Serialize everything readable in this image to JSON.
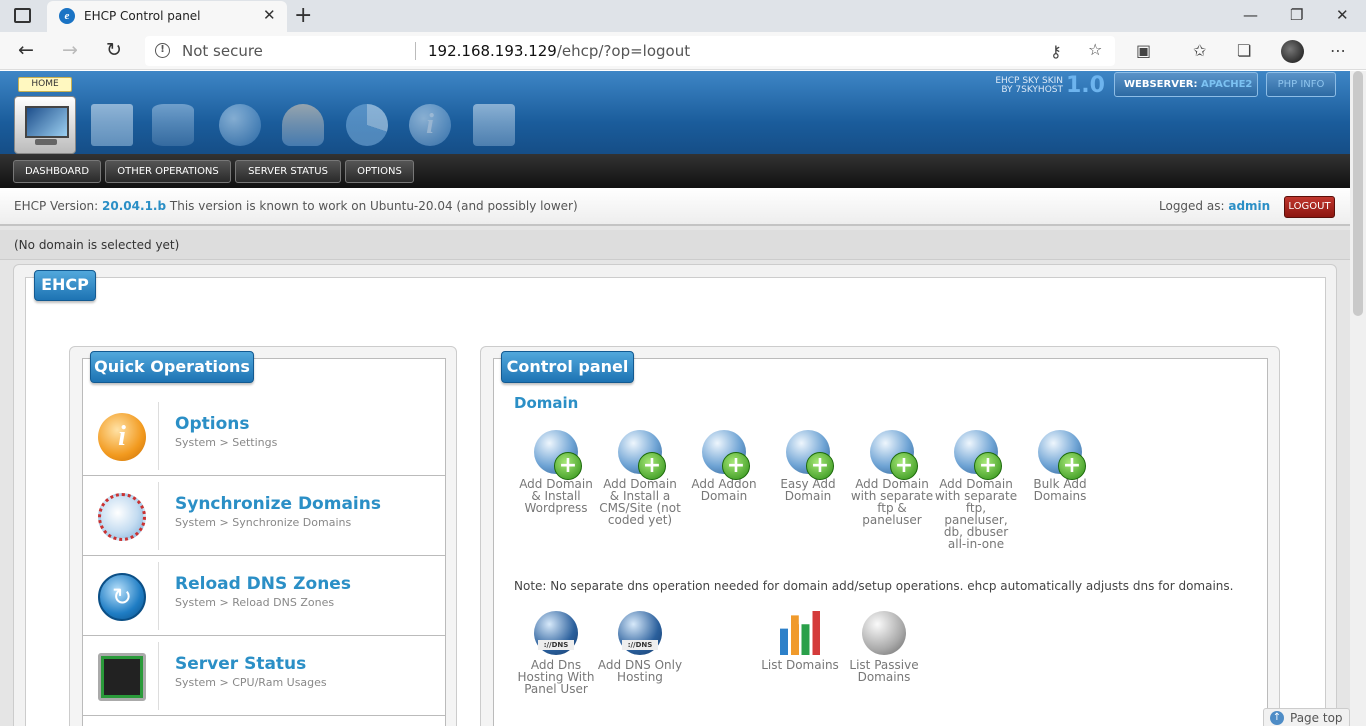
{
  "browser": {
    "tab_title": "EHCP Control panel",
    "tab_close": "✕",
    "new_tab": "+",
    "not_secure": "Not secure",
    "url_host": "192.168.193.129",
    "url_path": "/ehcp/?op=logout",
    "window_min": "—",
    "window_max": "❐",
    "window_close": "✕"
  },
  "header": {
    "home_badge": "HOME",
    "skin_line1": "EHCP SKY SKIN",
    "skin_line2": "BY 7SKYHOST",
    "skin_version": "1.0",
    "webserver_label": "WEBSERVER:",
    "webserver_value": "APACHE2",
    "php_info": "PHP INFO"
  },
  "menu": {
    "dashboard": "DASHBOARD",
    "other_operations": "OTHER OPERATIONS",
    "server_status": "SERVER STATUS",
    "options": "OPTIONS"
  },
  "info": {
    "version_label": "EHCP Version:",
    "version": "20.04.1.b",
    "version_note": "This version is known to work on Ubuntu-20.04 (and possibly lower)",
    "logged_label": "Logged as:",
    "user": "admin",
    "logout": "LOGOUT"
  },
  "domain_status": "(No domain is selected yet)",
  "main_tab": "EHCP",
  "quick_ops": {
    "title": "Quick Operations",
    "items": [
      {
        "title": "Options",
        "sub": "System > Settings",
        "color": "#f29a1f"
      },
      {
        "title": "Synchronize Domains",
        "sub": "System > Synchronize Domains",
        "color": "#c93232"
      },
      {
        "title": "Reload DNS Zones",
        "sub": "System > Reload DNS Zones",
        "color": "#1f7dc4"
      },
      {
        "title": "Server Status",
        "sub": "System > CPU/Ram Usages",
        "color": "#2a9a3a"
      }
    ]
  },
  "control_panel": {
    "title": "Control panel",
    "domain_heading": "Domain",
    "add_items": [
      "Add Domain & Install Wordpress",
      "Add Domain & Install a CMS/Site (not coded yet)",
      "Add Addon Domain",
      "Easy Add Domain",
      "Add Domain with separate ftp & paneluser",
      "Add Domain with separate ftp, paneluser, db, dbuser all-in-one",
      "Bulk Add Domains"
    ],
    "note": "Note: No separate dns operation needed for domain add/setup operations. ehcp automatically adjusts dns for domains.",
    "dns_items": [
      "Add Dns Hosting With Panel User",
      "Add DNS Only Hosting"
    ],
    "list_items": [
      "List Domains",
      "List Passive Domains"
    ]
  },
  "page_top": "Page top"
}
